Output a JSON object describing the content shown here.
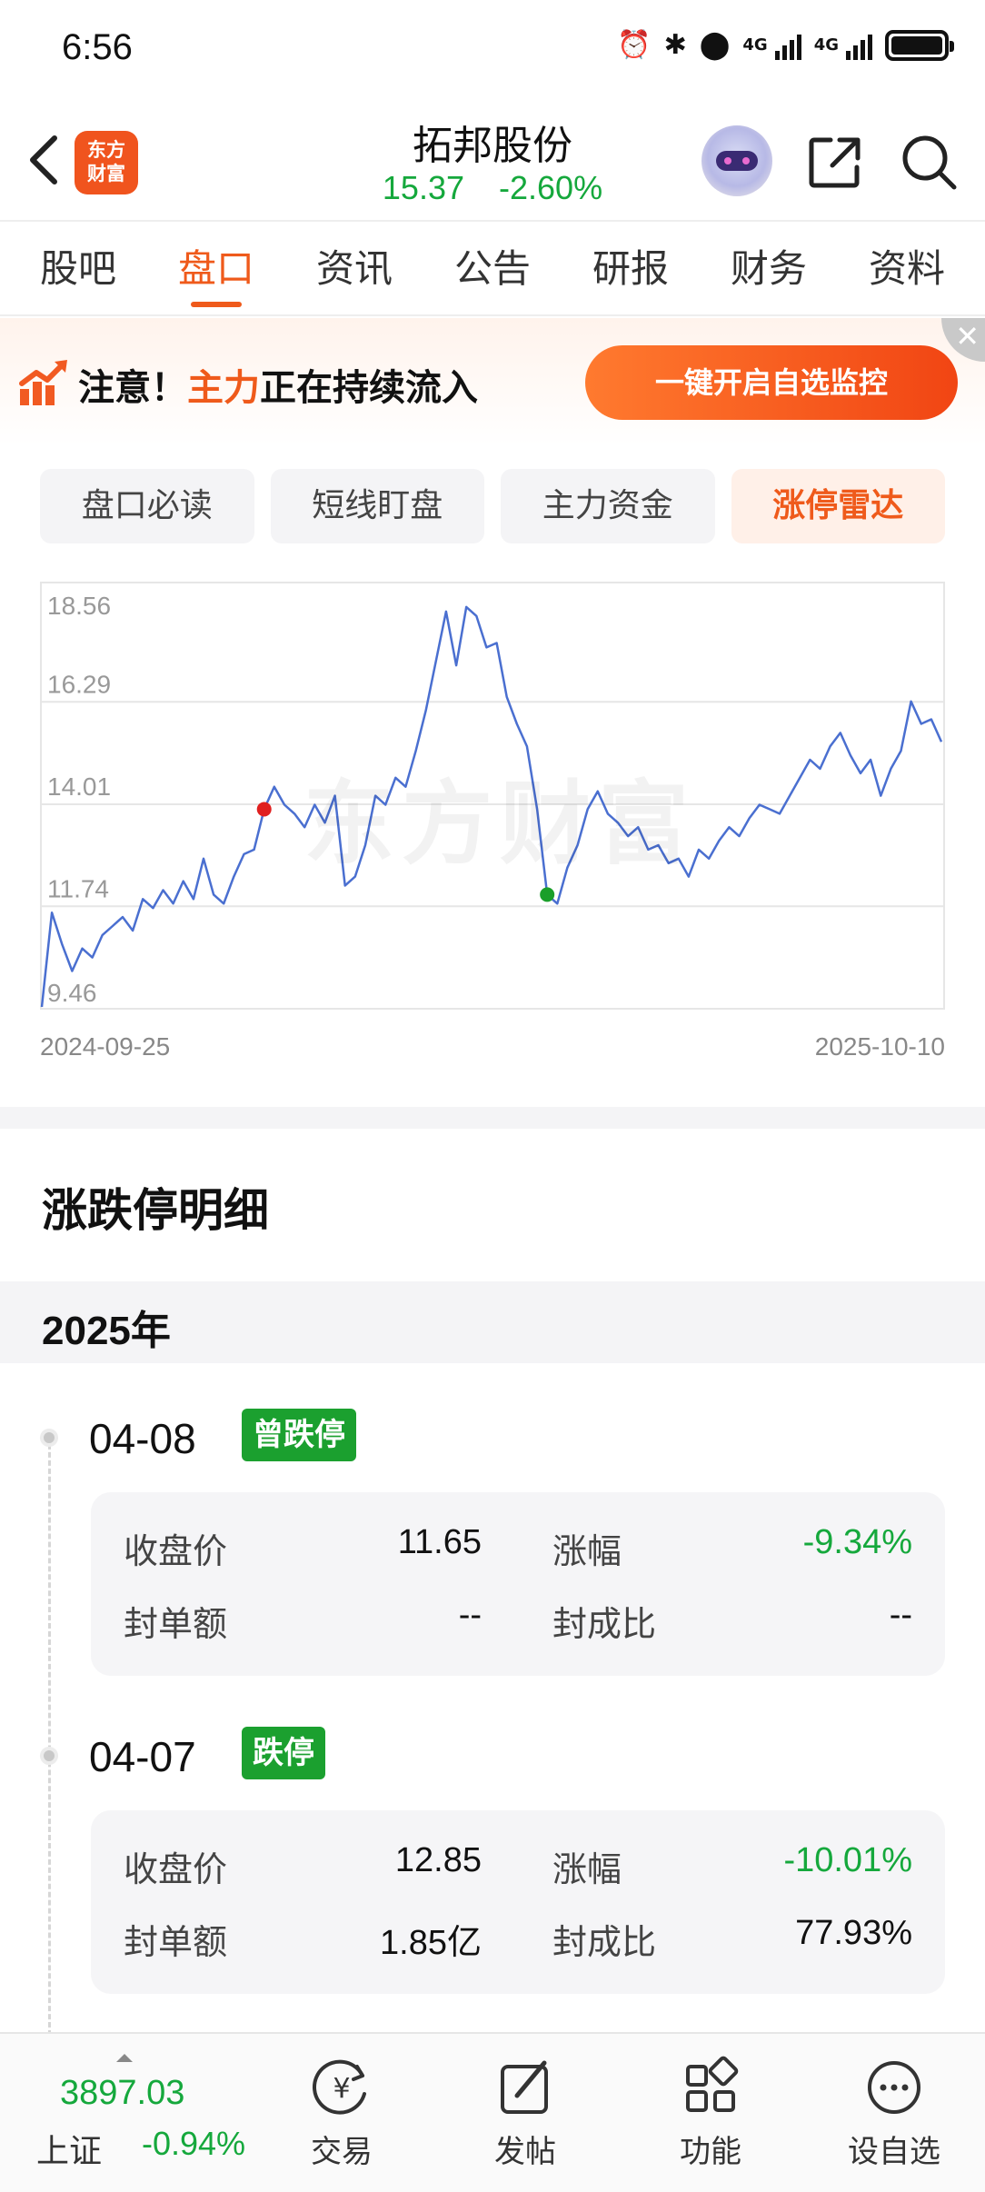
{
  "status_bar": {
    "time": "6:56",
    "network_1": "4G",
    "network_2": "4G"
  },
  "header": {
    "logo_text_line1": "东方",
    "logo_text_line2": "财富",
    "stock_name": "拓邦股份",
    "price": "15.37",
    "change_pct": "-2.60%",
    "quote_color": "#15a83c"
  },
  "tabs": [
    {
      "label": "股吧",
      "active": false
    },
    {
      "label": "盘口",
      "active": true
    },
    {
      "label": "资讯",
      "active": false
    },
    {
      "label": "公告",
      "active": false
    },
    {
      "label": "研报",
      "active": false
    },
    {
      "label": "财务",
      "active": false
    },
    {
      "label": "资料",
      "active": false
    }
  ],
  "banner": {
    "prefix": "注意！",
    "highlight": "主力",
    "suffix": "正在持续流入",
    "button_label": "一键开启自选监控",
    "close_symbol": "✕"
  },
  "subtabs": [
    {
      "label": "盘口必读",
      "active": false
    },
    {
      "label": "短线盯盘",
      "active": false
    },
    {
      "label": "主力资金",
      "active": false
    },
    {
      "label": "涨停雷达",
      "active": true
    }
  ],
  "chart_data": {
    "type": "line",
    "y_ticks": [
      "18.56",
      "16.29",
      "14.01",
      "11.74",
      "9.46"
    ],
    "ylim": [
      9.46,
      18.56
    ],
    "x_start_label": "2024-09-25",
    "x_end_label": "2025-10-10",
    "watermark": "东方财富",
    "line_color": "#4a6fd0",
    "values": [
      9.5,
      11.6,
      10.9,
      10.3,
      10.8,
      10.6,
      11.1,
      11.3,
      11.5,
      11.2,
      11.9,
      11.7,
      12.1,
      11.8,
      12.3,
      11.9,
      12.8,
      12.0,
      11.8,
      12.4,
      12.9,
      13.0,
      13.9,
      14.4,
      14.0,
      13.8,
      13.5,
      14.0,
      13.6,
      14.2,
      12.2,
      12.4,
      13.1,
      14.2,
      14.0,
      14.6,
      14.4,
      15.2,
      16.1,
      17.2,
      18.3,
      17.1,
      18.4,
      18.2,
      17.5,
      17.6,
      16.4,
      15.8,
      15.3,
      13.9,
      12.0,
      11.8,
      12.6,
      13.1,
      13.9,
      14.3,
      13.8,
      13.6,
      13.3,
      13.5,
      13.0,
      13.1,
      12.7,
      12.8,
      12.4,
      13.0,
      12.8,
      13.2,
      13.5,
      13.3,
      13.7,
      14.0,
      13.9,
      13.8,
      14.2,
      14.6,
      15.0,
      14.8,
      15.3,
      15.6,
      15.1,
      14.7,
      15.0,
      14.2,
      14.8,
      15.2,
      16.3,
      15.8,
      15.9,
      15.4
    ],
    "markers": [
      {
        "index": 22,
        "value": 13.9,
        "color": "#e02020",
        "kind": "up"
      },
      {
        "index": 50,
        "value": 12.0,
        "color": "#1a9f2a",
        "kind": "down"
      }
    ],
    "grid": true,
    "xlabel": "",
    "ylabel": ""
  },
  "section_title": "涨跌停明细",
  "year_label": "2025年",
  "entries": [
    {
      "date": "04-08",
      "badge": "曾跌停",
      "close_label": "收盘价",
      "close_value": "11.65",
      "change_label": "涨幅",
      "change_value": "-9.34%",
      "seal_label": "封单额",
      "seal_value": "--",
      "ratio_label": "封成比",
      "ratio_value": "--"
    },
    {
      "date": "04-07",
      "badge": "跌停",
      "close_label": "收盘价",
      "close_value": "12.85",
      "change_label": "涨幅",
      "change_value": "-10.01%",
      "seal_label": "封单额",
      "seal_value": "1.85亿",
      "ratio_label": "封成比",
      "ratio_value": "77.93%"
    }
  ],
  "bottom_nav": {
    "index_value": "3897.03",
    "index_name": "上证",
    "index_change": "-0.94%",
    "items": [
      {
        "label": "交易",
        "icon": "trade-icon"
      },
      {
        "label": "发帖",
        "icon": "post-icon"
      },
      {
        "label": "功能",
        "icon": "apps-icon"
      },
      {
        "label": "设自选",
        "icon": "more-icon"
      }
    ]
  }
}
